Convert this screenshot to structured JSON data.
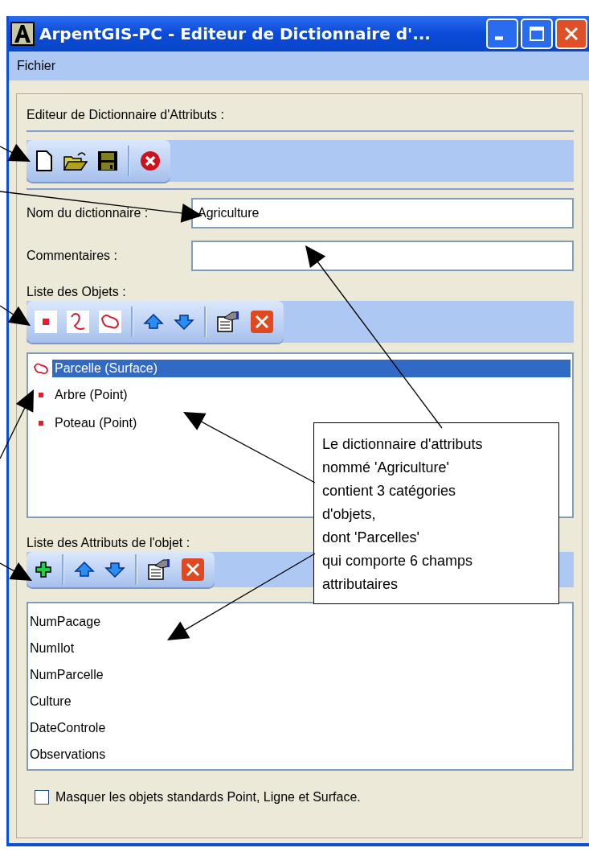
{
  "window": {
    "title": "ArpentGIS-PC - Editeur de Dictionnaire d'..."
  },
  "menu": [
    "Fichier"
  ],
  "editor_label": "Editeur de Dictionnaire d'Attributs :",
  "file_toolbar": [
    {
      "kind": "new"
    },
    {
      "kind": "open"
    },
    {
      "kind": "save"
    },
    {
      "kind": "separator"
    },
    {
      "kind": "cancel"
    }
  ],
  "fields": [
    {
      "label": "Nom du dictionnaire :",
      "value": "Agriculture"
    },
    {
      "label": "Commentaires :"
    }
  ],
  "objects_label": "Liste des Objets :",
  "objects_toolbar": [
    {
      "kind": "point"
    },
    {
      "kind": "line"
    },
    {
      "kind": "polygon"
    },
    {
      "kind": "separator"
    },
    {
      "kind": "up"
    },
    {
      "kind": "down"
    },
    {
      "kind": "separator"
    },
    {
      "kind": "properties"
    },
    {
      "kind": "delete"
    }
  ],
  "objects": [
    {
      "name": "Parcelle (Surface)",
      "kind": "polygon",
      "selected": true
    },
    {
      "name": "Arbre (Point)",
      "kind": "point",
      "selected": false
    },
    {
      "name": "Poteau (Point)",
      "kind": "point",
      "selected": false
    }
  ],
  "attributes_label": "Liste des Attributs de l'objet :",
  "attributes_toolbar": [
    {
      "kind": "add"
    },
    {
      "kind": "separator"
    },
    {
      "kind": "up"
    },
    {
      "kind": "down"
    },
    {
      "kind": "separator"
    },
    {
      "kind": "properties"
    },
    {
      "kind": "delete"
    }
  ],
  "attributes": [
    "NumPacage",
    "NumIlot",
    "NumParcelle",
    "Culture",
    "DateControle",
    "Observations"
  ],
  "hide_standard": {
    "label": "Masquer les objets standards Point, Ligne et Surface.",
    "checked": false
  },
  "callout": [
    "Le dictionnaire d'attributs",
    "nommé 'Agriculture'",
    "contient 3 catégories",
    "d'objets,",
    "dont 'Parcelles'",
    "qui comporte 6 champs",
    "attributaires"
  ]
}
